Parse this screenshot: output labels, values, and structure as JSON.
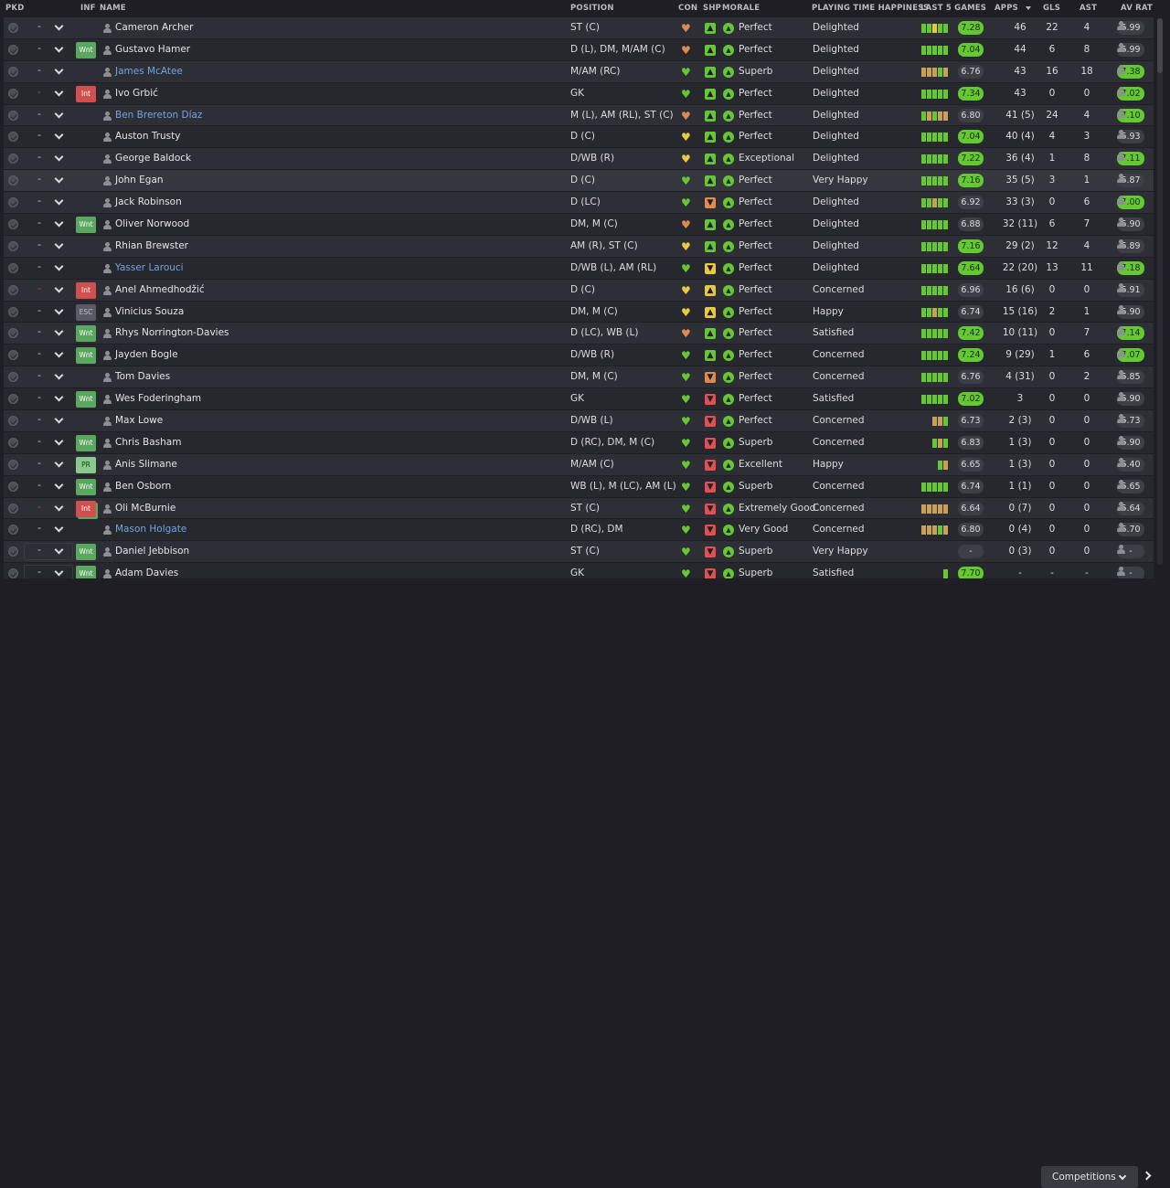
{
  "headers": {
    "pkd": "PKD",
    "inf": "INF",
    "name": "NAME",
    "position": "POSITION",
    "con": "CON",
    "shp": "SHP",
    "morale": "MORALE",
    "pth": "PLAYING TIME HAPPINESS",
    "last5": "LAST 5 GAMES",
    "apps": "APPS",
    "gls": "GLS",
    "ast": "AST",
    "avrat": "AV RAT"
  },
  "colors": {
    "green": "#64c832",
    "orange": "#e08a50",
    "yellow": "#e8c840",
    "red": "#e05050",
    "grey": "#9a9aa0",
    "tan": "#c8a058"
  },
  "players": [
    {
      "pk": "-",
      "red": false,
      "inf": "",
      "name": "Cameron Archer",
      "loan": false,
      "pos": "ST (C)",
      "con": "orange",
      "shp": "green",
      "shpg": "▲",
      "mor": "green",
      "morale": "Perfect",
      "pth": "Delighted",
      "l5": [
        "g",
        "g",
        "y",
        "g",
        "g"
      ],
      "l5r": "7.28",
      "l5g": true,
      "apps": "46",
      "gls": "22",
      "ast": "4",
      "av": "6.99",
      "avg": false
    },
    {
      "pk": "-",
      "red": false,
      "inf": "Wnt",
      "name": "Gustavo Hamer",
      "loan": false,
      "pos": "D (L), DM, M/AM (C)",
      "con": "orange",
      "shp": "green",
      "shpg": "▲",
      "mor": "green",
      "morale": "Perfect",
      "pth": "Delighted",
      "l5": [
        "g",
        "g",
        "g",
        "g",
        "g"
      ],
      "l5r": "7.04",
      "l5g": true,
      "apps": "44",
      "gls": "6",
      "ast": "8",
      "av": "6.99",
      "avg": false
    },
    {
      "pk": "-",
      "red": false,
      "inf": "",
      "name": "James McAtee",
      "loan": true,
      "pos": "M/AM (RC)",
      "con": "green",
      "shp": "green",
      "shpg": "▲",
      "mor": "green",
      "morale": "Superb",
      "pth": "Delighted",
      "l5": [
        "t",
        "t",
        "t",
        "g",
        "t"
      ],
      "l5r": "6.76",
      "l5g": false,
      "apps": "43",
      "gls": "16",
      "ast": "18",
      "av": "7.38",
      "avg": true
    },
    {
      "pk": "-",
      "red": true,
      "inf": "Int",
      "name": "Ivo Grbić",
      "loan": false,
      "pos": "GK",
      "con": "green",
      "shp": "green",
      "shpg": "▲",
      "mor": "green",
      "morale": "Perfect",
      "pth": "Delighted",
      "l5": [
        "g",
        "g",
        "g",
        "g",
        "g"
      ],
      "l5r": "7.34",
      "l5g": true,
      "apps": "43",
      "gls": "0",
      "ast": "0",
      "av": "7.02",
      "avg": true
    },
    {
      "pk": "-",
      "red": false,
      "inf": "",
      "name": "Ben Brereton Díaz",
      "loan": true,
      "pos": "M (L), AM (RL), ST (C)",
      "con": "orange",
      "shp": "green",
      "shpg": "▲",
      "mor": "green",
      "morale": "Perfect",
      "pth": "Delighted",
      "l5": [
        "g",
        "t",
        "g",
        "t",
        "t"
      ],
      "l5r": "6.80",
      "l5g": false,
      "apps": "41 (5)",
      "gls": "24",
      "ast": "4",
      "av": "7.10",
      "avg": true
    },
    {
      "pk": "-",
      "red": false,
      "inf": "",
      "name": "Auston Trusty",
      "loan": false,
      "pos": "D (C)",
      "con": "yellow",
      "shp": "green",
      "shpg": "▲",
      "mor": "green",
      "morale": "Perfect",
      "pth": "Delighted",
      "l5": [
        "g",
        "g",
        "g",
        "g",
        "g"
      ],
      "l5r": "7.04",
      "l5g": true,
      "apps": "40 (4)",
      "gls": "4",
      "ast": "3",
      "av": "6.93",
      "avg": false
    },
    {
      "pk": "-",
      "red": false,
      "inf": "",
      "name": "George Baldock",
      "loan": false,
      "pos": "D/WB (R)",
      "con": "yellow",
      "shp": "green",
      "shpg": "▲",
      "mor": "green",
      "morale": "Exceptional",
      "pth": "Delighted",
      "l5": [
        "g",
        "g",
        "g",
        "g",
        "g"
      ],
      "l5r": "7.22",
      "l5g": true,
      "apps": "36 (4)",
      "gls": "1",
      "ast": "8",
      "av": "7.11",
      "avg": true
    },
    {
      "pk": "-",
      "red": false,
      "inf": "",
      "name": "John Egan",
      "loan": false,
      "pos": "D (C)",
      "con": "green",
      "shp": "green",
      "shpg": "▲",
      "mor": "green",
      "morale": "Perfect",
      "pth": "Very Happy",
      "l5": [
        "g",
        "g",
        "g",
        "g",
        "g"
      ],
      "l5r": "7.16",
      "l5g": true,
      "apps": "35 (5)",
      "gls": "3",
      "ast": "1",
      "av": "6.87",
      "avg": false,
      "hl": true
    },
    {
      "pk": "-",
      "red": false,
      "inf": "",
      "name": "Jack Robinson",
      "loan": false,
      "pos": "D (LC)",
      "con": "green",
      "shp": "orange",
      "shpg": "▼",
      "mor": "green",
      "morale": "Perfect",
      "pth": "Delighted",
      "l5": [
        "g",
        "g",
        "t",
        "g",
        "g"
      ],
      "l5r": "6.92",
      "l5g": false,
      "apps": "33 (3)",
      "gls": "0",
      "ast": "6",
      "av": "7.00",
      "avg": true
    },
    {
      "pk": "-",
      "red": false,
      "inf": "Wnt",
      "name": "Oliver Norwood",
      "loan": false,
      "pos": "DM, M (C)",
      "con": "orange",
      "shp": "green",
      "shpg": "▲",
      "mor": "green",
      "morale": "Perfect",
      "pth": "Delighted",
      "l5": [
        "g",
        "g",
        "g",
        "g",
        "g"
      ],
      "l5r": "6.88",
      "l5g": false,
      "apps": "32 (11)",
      "gls": "6",
      "ast": "7",
      "av": "6.90",
      "avg": false
    },
    {
      "pk": "-",
      "red": false,
      "inf": "",
      "name": "Rhian Brewster",
      "loan": false,
      "pos": "AM (R), ST (C)",
      "con": "yellow",
      "shp": "green",
      "shpg": "▲",
      "mor": "green",
      "morale": "Perfect",
      "pth": "Delighted",
      "l5": [
        "g",
        "g",
        "g",
        "g",
        "g"
      ],
      "l5r": "7.16",
      "l5g": true,
      "apps": "29 (2)",
      "gls": "12",
      "ast": "4",
      "av": "6.89",
      "avg": false
    },
    {
      "pk": "-",
      "red": false,
      "inf": "",
      "name": "Yasser Larouci",
      "loan": true,
      "pos": "D/WB (L), AM (RL)",
      "con": "green",
      "shp": "yellow",
      "shpg": "▼",
      "mor": "green",
      "morale": "Perfect",
      "pth": "Delighted",
      "l5": [
        "g",
        "g",
        "g",
        "g",
        "g"
      ],
      "l5r": "7.64",
      "l5g": true,
      "apps": "22 (20)",
      "gls": "13",
      "ast": "11",
      "av": "7.18",
      "avg": true
    },
    {
      "pk": "-",
      "red": true,
      "inf": "Int",
      "name": "Anel Ahmedhodžić",
      "loan": false,
      "pos": "D (C)",
      "con": "yellow",
      "shp": "yellow",
      "shpg": "▲",
      "mor": "green",
      "morale": "Perfect",
      "pth": "Concerned",
      "l5": [
        "g",
        "g",
        "g",
        "g",
        "g"
      ],
      "l5r": "6.96",
      "l5g": false,
      "apps": "16 (6)",
      "gls": "0",
      "ast": "0",
      "av": "6.91",
      "avg": false
    },
    {
      "pk": "-",
      "red": false,
      "inf": "ESC",
      "name": "Vinicius Souza",
      "loan": false,
      "pos": "DM, M (C)",
      "con": "yellow",
      "shp": "yellow",
      "shpg": "▲",
      "mor": "green",
      "morale": "Perfect",
      "pth": "Happy",
      "l5": [
        "g",
        "g",
        "t",
        "g",
        "g"
      ],
      "l5r": "6.74",
      "l5g": false,
      "apps": "15 (16)",
      "gls": "2",
      "ast": "1",
      "av": "6.90",
      "avg": false
    },
    {
      "pk": "-",
      "red": false,
      "inf": "Wnt",
      "name": "Rhys Norrington-Davies",
      "loan": false,
      "pos": "D (LC), WB (L)",
      "con": "orange",
      "shp": "green",
      "shpg": "▲",
      "mor": "green",
      "morale": "Perfect",
      "pth": "Satisfied",
      "l5": [
        "g",
        "g",
        "g",
        "g",
        "g"
      ],
      "l5r": "7.42",
      "l5g": true,
      "apps": "10 (11)",
      "gls": "0",
      "ast": "7",
      "av": "7.14",
      "avg": true
    },
    {
      "pk": "-",
      "red": false,
      "inf": "Wnt",
      "name": "Jayden Bogle",
      "loan": false,
      "pos": "D/WB (R)",
      "con": "green",
      "shp": "green",
      "shpg": "▲",
      "mor": "green",
      "morale": "Perfect",
      "pth": "Concerned",
      "l5": [
        "g",
        "g",
        "g",
        "g",
        "g"
      ],
      "l5r": "7.24",
      "l5g": true,
      "apps": "9 (29)",
      "gls": "1",
      "ast": "6",
      "av": "7.07",
      "avg": true
    },
    {
      "pk": "-",
      "red": false,
      "inf": "",
      "name": "Tom Davies",
      "loan": false,
      "pos": "DM, M (C)",
      "con": "green",
      "shp": "orange",
      "shpg": "▼",
      "mor": "green",
      "morale": "Perfect",
      "pth": "Concerned",
      "l5": [
        "g",
        "g",
        "g",
        "g",
        "g"
      ],
      "l5r": "6.76",
      "l5g": false,
      "apps": "4 (31)",
      "gls": "0",
      "ast": "2",
      "av": "6.85",
      "avg": false
    },
    {
      "pk": "-",
      "red": false,
      "inf": "Wnt",
      "name": "Wes Foderingham",
      "loan": false,
      "pos": "GK",
      "con": "green",
      "shp": "red",
      "shpg": "▼",
      "mor": "green",
      "morale": "Perfect",
      "pth": "Satisfied",
      "l5": [
        "g",
        "g",
        "g",
        "g",
        "g"
      ],
      "l5r": "7.02",
      "l5g": true,
      "apps": "3",
      "gls": "0",
      "ast": "0",
      "av": "6.90",
      "avg": false
    },
    {
      "pk": "-",
      "red": false,
      "inf": "",
      "name": "Max Lowe",
      "loan": false,
      "pos": "D/WB (L)",
      "con": "green",
      "shp": "red",
      "shpg": "▼",
      "mor": "green",
      "morale": "Perfect",
      "pth": "Concerned",
      "l5": [
        "",
        "",
        "t",
        "t",
        "g"
      ],
      "l5r": "6.73",
      "l5g": false,
      "apps": "2 (3)",
      "gls": "0",
      "ast": "0",
      "av": "6.73",
      "avg": false
    },
    {
      "pk": "-",
      "red": false,
      "inf": "Wnt",
      "name": "Chris Basham",
      "loan": false,
      "pos": "D (RC), DM, M (C)",
      "con": "green",
      "shp": "red",
      "shpg": "▼",
      "mor": "green",
      "morale": "Superb",
      "pth": "Concerned",
      "l5": [
        "",
        "",
        "g",
        "t",
        "g"
      ],
      "l5r": "6.83",
      "l5g": false,
      "apps": "1 (3)",
      "gls": "0",
      "ast": "0",
      "av": "6.90",
      "avg": false
    },
    {
      "pk": "-",
      "red": false,
      "inf": "PR",
      "name": "Anis Slimane",
      "loan": false,
      "pos": "M/AM (C)",
      "con": "green",
      "shp": "red",
      "shpg": "▼",
      "mor": "green",
      "morale": "Excellent",
      "pth": "Happy",
      "l5": [
        "",
        "",
        "",
        "g",
        "t"
      ],
      "l5r": "6.65",
      "l5g": false,
      "apps": "1 (3)",
      "gls": "0",
      "ast": "0",
      "av": "6.40",
      "avg": false
    },
    {
      "pk": "-",
      "red": false,
      "inf": "Wnt",
      "name": "Ben Osborn",
      "loan": false,
      "pos": "WB (L), M (LC), AM (L)",
      "con": "green",
      "shp": "red",
      "shpg": "▼",
      "mor": "green",
      "morale": "Superb",
      "pth": "Concerned",
      "l5": [
        "g",
        "g",
        "g",
        "g",
        "g"
      ],
      "l5r": "6.74",
      "l5g": false,
      "apps": "1 (1)",
      "gls": "0",
      "ast": "0",
      "av": "6.65",
      "avg": false
    },
    {
      "pk": "-",
      "red": true,
      "inf": "Int",
      "name": "Oli McBurnie",
      "loan": false,
      "pos": "ST (C)",
      "con": "green",
      "shp": "red",
      "shpg": "▼",
      "mor": "green",
      "morale": "Extremely Good",
      "pth": "Concerned",
      "l5": [
        "t",
        "t",
        "t",
        "t",
        "t"
      ],
      "l5r": "6.64",
      "l5g": false,
      "apps": "0 (7)",
      "gls": "0",
      "ast": "0",
      "av": "6.64",
      "avg": false,
      "stack": true
    },
    {
      "pk": "-",
      "red": false,
      "inf": "",
      "name": "Mason Holgate",
      "loan": true,
      "pos": "D (RC), DM",
      "con": "green",
      "shp": "red",
      "shpg": "▼",
      "mor": "green",
      "morale": "Very Good",
      "pth": "Concerned",
      "l5": [
        "t",
        "t",
        "t",
        "g",
        "t"
      ],
      "l5r": "6.80",
      "l5g": false,
      "apps": "0 (4)",
      "gls": "0",
      "ast": "0",
      "av": "6.70",
      "avg": false
    },
    {
      "pk": "-",
      "red": false,
      "inf": "Wnt",
      "name": "Daniel Jebbison",
      "loan": false,
      "pos": "ST (C)",
      "con": "green",
      "shp": "red",
      "shpg": "▼",
      "mor": "green",
      "morale": "Superb",
      "pth": "Very Happy",
      "l5": [
        "",
        "",
        "",
        "",
        ""
      ],
      "l5r": "-",
      "l5g": false,
      "apps": "0 (3)",
      "gls": "0",
      "ast": "0",
      "av": "-",
      "avg": false,
      "box": true
    },
    {
      "pk": "-",
      "red": false,
      "inf": "Wnt",
      "name": "Adam Davies",
      "loan": false,
      "pos": "GK",
      "con": "green",
      "shp": "red",
      "shpg": "▼",
      "mor": "green",
      "morale": "Superb",
      "pth": "Satisfied",
      "l5": [
        "",
        "",
        "",
        "",
        "g"
      ],
      "l5r": "7.70",
      "l5g": true,
      "apps": "-",
      "gls": "-",
      "ast": "-",
      "av": "-",
      "avg": false,
      "box": true
    }
  ],
  "footer": {
    "competitions": "Competitions"
  }
}
